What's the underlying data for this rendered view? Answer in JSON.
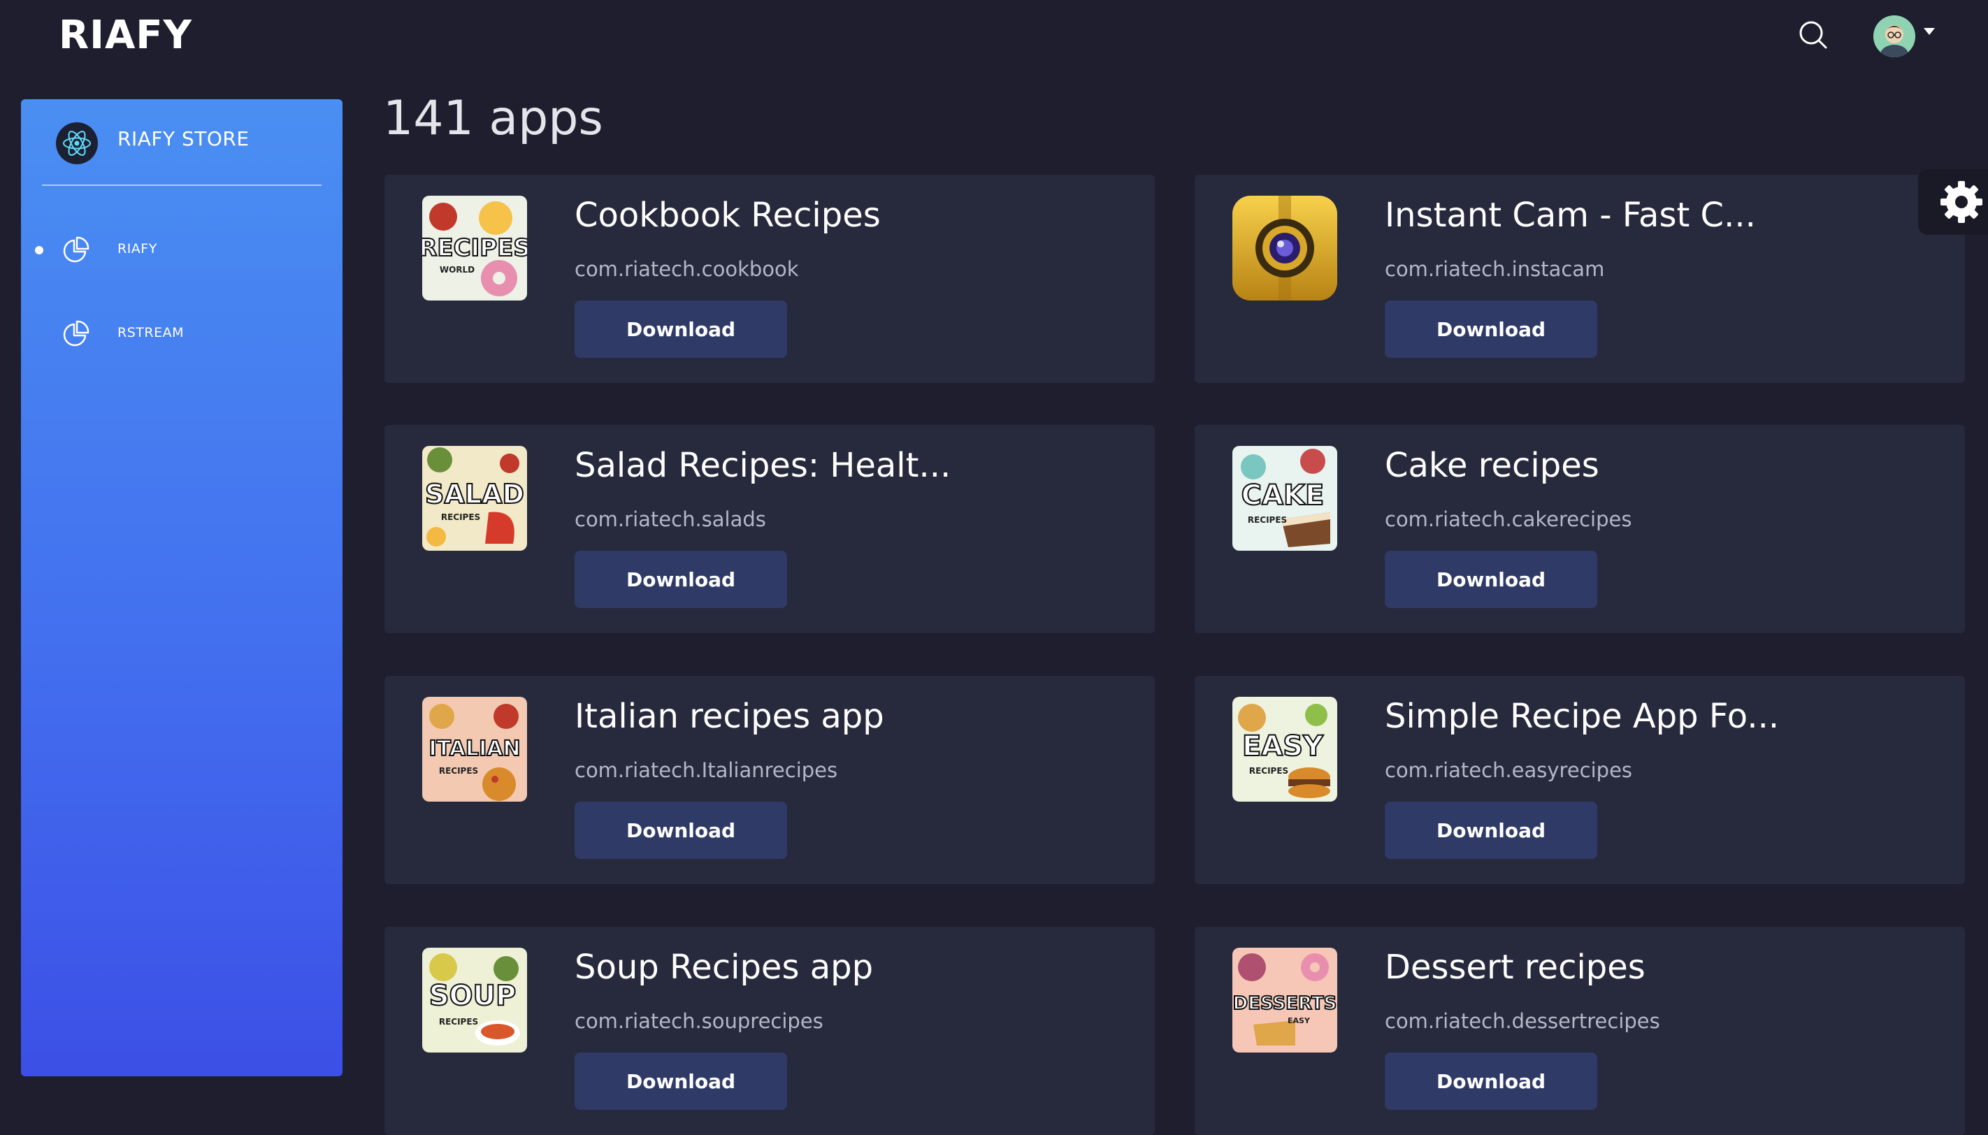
{
  "header": {
    "brand": "RIAFY"
  },
  "sidebar": {
    "store_name": "RIAFY STORE",
    "items": [
      {
        "label": "RIAFY",
        "active": true
      },
      {
        "label": "RSTREAM",
        "active": false
      }
    ]
  },
  "main": {
    "count_label": "141 apps",
    "download_label": "Download",
    "apps": [
      {
        "name": "Cookbook Recipes",
        "package": "com.riatech.cookbook",
        "icon_text": "RECIPES",
        "icon_subtext": "WORLD"
      },
      {
        "name": "Instant Cam - Fast C...",
        "package": "com.riatech.instacam",
        "icon_text": "",
        "icon_subtext": ""
      },
      {
        "name": "Salad Recipes: Healt...",
        "package": "com.riatech.salads",
        "icon_text": "SALAD",
        "icon_subtext": "RECIPES"
      },
      {
        "name": "Cake recipes",
        "package": "com.riatech.cakerecipes",
        "icon_text": "CAKE",
        "icon_subtext": "RECIPES"
      },
      {
        "name": "Italian recipes app",
        "package": "com.riatech.Italianrecipes",
        "icon_text": "ITALIAN",
        "icon_subtext": "RECIPES"
      },
      {
        "name": "Simple Recipe App Fo...",
        "package": "com.riatech.easyrecipes",
        "icon_text": "EASY",
        "icon_subtext": "RECIPES"
      },
      {
        "name": "Soup Recipes app",
        "package": "com.riatech.souprecipes",
        "icon_text": "SOUP",
        "icon_subtext": "RECIPES"
      },
      {
        "name": "Dessert recipes",
        "package": "com.riatech.dessertrecipes",
        "icon_text": "DESSERTS",
        "icon_subtext": "EASY"
      }
    ]
  },
  "colors": {
    "background": "#1e1e2e",
    "card": "#27293d",
    "button": "#2f3b66",
    "sidebar_top": "#4a8ff2",
    "sidebar_bottom": "#3c4fe6"
  },
  "icons": {
    "search": "search-icon",
    "avatar": "avatar",
    "caret": "caret-down-icon",
    "store": "react-logo-icon",
    "nav": "pie-chart-icon",
    "settings": "gear-icon"
  }
}
